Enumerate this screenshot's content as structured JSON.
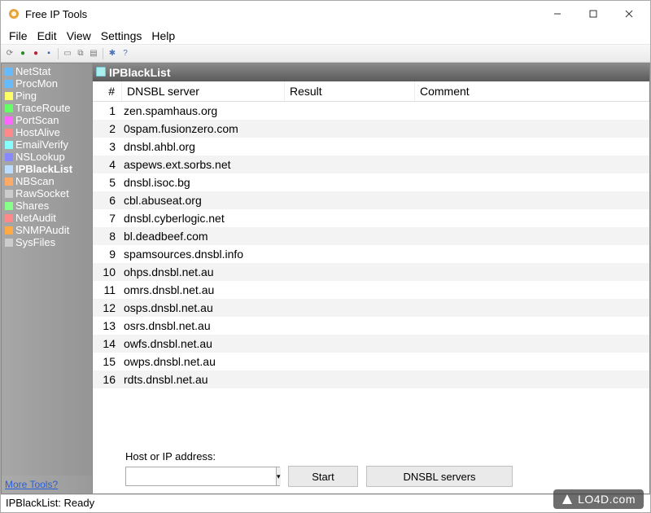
{
  "window": {
    "title": "Free IP Tools"
  },
  "menu": [
    "File",
    "Edit",
    "View",
    "Settings",
    "Help"
  ],
  "sidebar": {
    "items": [
      {
        "label": "NetStat",
        "sel": false
      },
      {
        "label": "ProcMon",
        "sel": false
      },
      {
        "label": "Ping",
        "sel": false
      },
      {
        "label": "TraceRoute",
        "sel": false
      },
      {
        "label": "PortScan",
        "sel": false
      },
      {
        "label": "HostAlive",
        "sel": false
      },
      {
        "label": "EmailVerify",
        "sel": false
      },
      {
        "label": "NSLookup",
        "sel": false
      },
      {
        "label": "IPBlackList",
        "sel": true
      },
      {
        "label": "NBScan",
        "sel": false
      },
      {
        "label": "RawSocket",
        "sel": false
      },
      {
        "label": "Shares",
        "sel": false
      },
      {
        "label": "NetAudit",
        "sel": false
      },
      {
        "label": "SNMPAudit",
        "sel": false
      },
      {
        "label": "SysFiles",
        "sel": false
      }
    ],
    "more": "More Tools?"
  },
  "panel": {
    "title": "IPBlackList",
    "columns": [
      "#",
      "DNSBL server",
      "Result",
      "Comment"
    ],
    "rows": [
      {
        "n": 1,
        "server": "zen.spamhaus.org"
      },
      {
        "n": 2,
        "server": "0spam.fusionzero.com"
      },
      {
        "n": 3,
        "server": "dnsbl.ahbl.org"
      },
      {
        "n": 4,
        "server": "aspews.ext.sorbs.net"
      },
      {
        "n": 5,
        "server": "dnsbl.isoc.bg"
      },
      {
        "n": 6,
        "server": "cbl.abuseat.org"
      },
      {
        "n": 7,
        "server": "dnsbl.cyberlogic.net"
      },
      {
        "n": 8,
        "server": "bl.deadbeef.com"
      },
      {
        "n": 9,
        "server": "spamsources.dnsbl.info"
      },
      {
        "n": 10,
        "server": "ohps.dnsbl.net.au"
      },
      {
        "n": 11,
        "server": "omrs.dnsbl.net.au"
      },
      {
        "n": 12,
        "server": "osps.dnsbl.net.au"
      },
      {
        "n": 13,
        "server": "osrs.dnsbl.net.au"
      },
      {
        "n": 14,
        "server": "owfs.dnsbl.net.au"
      },
      {
        "n": 15,
        "server": "owps.dnsbl.net.au"
      },
      {
        "n": 16,
        "server": "rdts.dnsbl.net.au"
      }
    ]
  },
  "form": {
    "host_label": "Host or IP address:",
    "host_value": "",
    "start_label": "Start",
    "dnsbl_label": "DNSBL servers"
  },
  "status": "IPBlackList: Ready",
  "watermark": "LO4D.com"
}
